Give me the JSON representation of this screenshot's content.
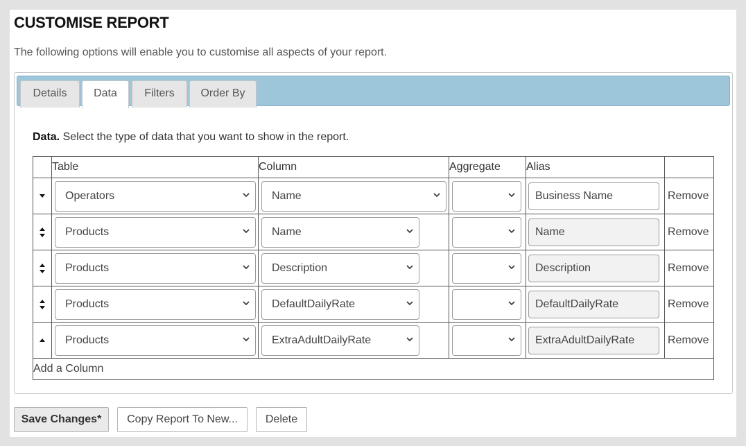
{
  "header": {
    "title": "CUSTOMISE REPORT",
    "subtitle": "The following options will enable you to customise all aspects of your report."
  },
  "tabs": [
    {
      "label": "Details",
      "active": false
    },
    {
      "label": "Data",
      "active": true
    },
    {
      "label": "Filters",
      "active": false
    },
    {
      "label": "Order By",
      "active": false
    }
  ],
  "data_section": {
    "heading": "Data.",
    "description": " Select the type of data that you want to show in the report.",
    "columns": [
      "",
      "Table",
      "Column",
      "Aggregate",
      "Alias",
      ""
    ],
    "rows": [
      {
        "mover": "down",
        "table": "Operators",
        "column": "Name",
        "aggregate": "",
        "alias": "Business Name",
        "action": "Remove"
      },
      {
        "mover": "both",
        "table": "Products",
        "column": "Name",
        "aggregate": "",
        "alias": "Name",
        "action": "Remove"
      },
      {
        "mover": "both",
        "table": "Products",
        "column": "Description",
        "aggregate": "",
        "alias": "Description",
        "action": "Remove"
      },
      {
        "mover": "both",
        "table": "Products",
        "column": "DefaultDailyRate",
        "aggregate": "",
        "alias": "DefaultDailyRate",
        "action": "Remove"
      },
      {
        "mover": "up",
        "table": "Products",
        "column": "ExtraAdultDailyRate",
        "aggregate": "",
        "alias": "ExtraAdultDailyRate",
        "action": "Remove"
      }
    ],
    "add_column_label": "Add a Column"
  },
  "buttons": {
    "save": "Save Changes*",
    "copy": "Copy Report To New...",
    "delete": "Delete"
  },
  "colors": {
    "tab_bar": "#9ec6da",
    "page_bg": "#e2e2e2"
  }
}
